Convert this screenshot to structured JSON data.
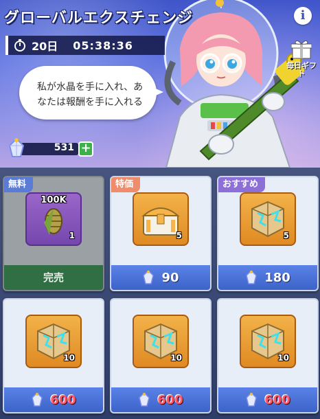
{
  "header": {
    "title": "グローバルエクスチェンジ",
    "timer_days": "20日",
    "timer_clock": "05:38:36",
    "speech": "私が水晶を手に入れ、あなたは報酬を手に入れる",
    "gift_label": "毎日ギフト",
    "currency_value": "531"
  },
  "colors": {
    "price_normal": "#ffffff",
    "price_red": "#ff5a6a",
    "sold_out_bar": "#2f6f43",
    "price_bar": "#3c63c9"
  },
  "items": [
    {
      "tag": "無料",
      "label_top": "100K",
      "qty": "1",
      "status": "完売",
      "icon": "corn-cob-icon"
    },
    {
      "tag": "特価",
      "qty": "5",
      "price": "90",
      "icon": "treasure-chest-icon"
    },
    {
      "tag": "おすすめ",
      "qty": "5",
      "price": "180",
      "icon": "crystal-cube-icon"
    },
    {
      "qty": "10",
      "price": "600",
      "icon": "crystal-cube-icon"
    },
    {
      "qty": "10",
      "price": "600",
      "icon": "crystal-cube-icon"
    },
    {
      "qty": "10",
      "price": "600",
      "icon": "crystal-cube-icon"
    }
  ]
}
